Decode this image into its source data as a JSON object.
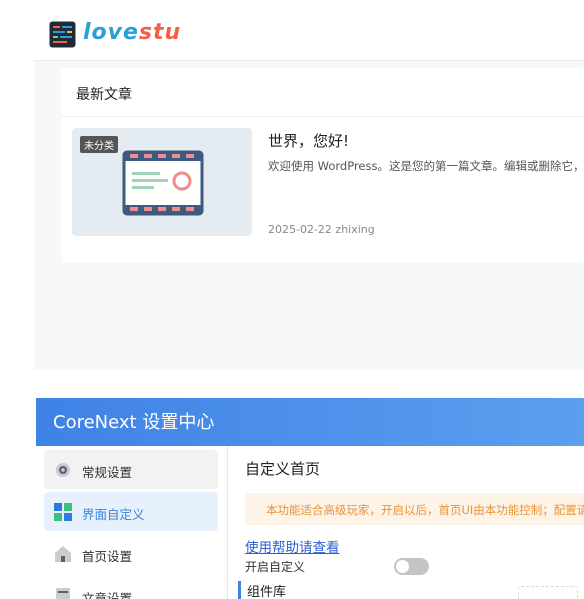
{
  "site": {
    "logo_part1": "love",
    "logo_part2": "stu",
    "section_title": "最新文章",
    "post": {
      "category_tag": "未分类",
      "title": "世界，您好!",
      "excerpt": "欢迎使用 WordPress。这是您的第一篇文章。编辑或删除它，",
      "meta": "2025-02-22 zhixing"
    }
  },
  "settings": {
    "title": "CoreNext 设置中心",
    "nav": [
      {
        "label": "常规设置",
        "icon": "gear-icon"
      },
      {
        "label": "界面自定义",
        "icon": "grid-icon"
      },
      {
        "label": "首页设置",
        "icon": "home-icon"
      },
      {
        "label": "文章设置",
        "icon": "document-icon"
      }
    ],
    "content": {
      "title": "自定义首页",
      "notice": "本功能适合高级玩家，开启以后，首页UI由本功能控制；配置请",
      "help_link": "使用帮助请查看",
      "toggle_label": "开启自定义",
      "toggle_on": false,
      "section": "组件库"
    }
  },
  "colors": {
    "header_gradient_start": "#3f82e6",
    "header_gradient_end": "#5b9fef",
    "active_nav_bg": "#e6f1fd",
    "active_nav_text": "#3b82d6",
    "notice_bg": "#fdf3e6",
    "notice_text": "#e8943a",
    "link": "#2b5fd0",
    "logo_blue": "#2a9fd6",
    "logo_red": "#f2604c"
  }
}
